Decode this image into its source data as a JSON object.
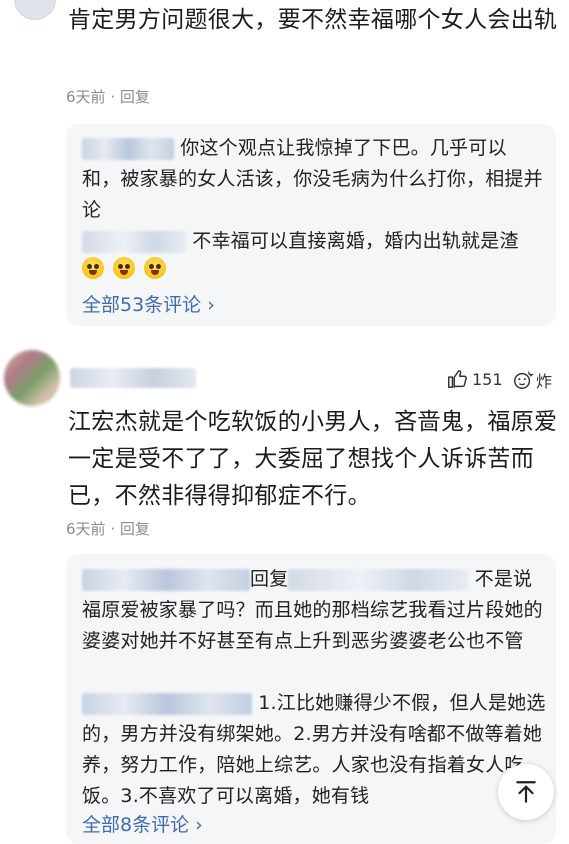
{
  "comment1": {
    "text": "肯定男方问题很大，要不然幸福哪个女人会出轨",
    "time": "6天前",
    "separator": "·",
    "reply_label": "回复",
    "replies": [
      {
        "text": "你这个观点让我惊掉了下巴。几乎可以和，被家暴的女人活该，你没毛病为什么打你，相提并论"
      },
      {
        "text": "不幸福可以直接离婚，婚内出轨就是渣"
      }
    ],
    "more": "全部53条评论",
    "more_arrow": "›"
  },
  "comment2": {
    "like_count": "151",
    "react_label": "炸",
    "text": "江宏杰就是个吃软饭的小男人，吝啬鬼，福原爱一定是受不了了，大委屈了想找个人诉诉苦而已，不然非得得抑郁症不行。",
    "time": "6天前",
    "separator": "·",
    "reply_label": "回复",
    "replies": [
      {
        "prefix": "回复",
        "text": "不是说福原爱被家暴了吗？而且她的那档综艺我看过片段她的婆婆对她并不好甚至有点上升到恶劣婆婆老公也不管"
      },
      {
        "text": "1.江比她赚得少不假，但人是她选的，男方并没有绑架她。2.男方并没有啥都不做等着她养，努力工作，陪她上综艺。人家也没有指着女人吃饭。3.不喜欢了可以离婚，她有钱"
      }
    ],
    "more": "全部8条评论",
    "more_arrow": "›"
  },
  "icons": {
    "like": "thumbs-up-icon",
    "react": "explode-emoji-icon",
    "scroll_top": "arrow-up-icon"
  },
  "colors": {
    "link": "#3f6cb0",
    "meta": "#8c8c8c",
    "reply_bg": "#f5f6f8"
  }
}
